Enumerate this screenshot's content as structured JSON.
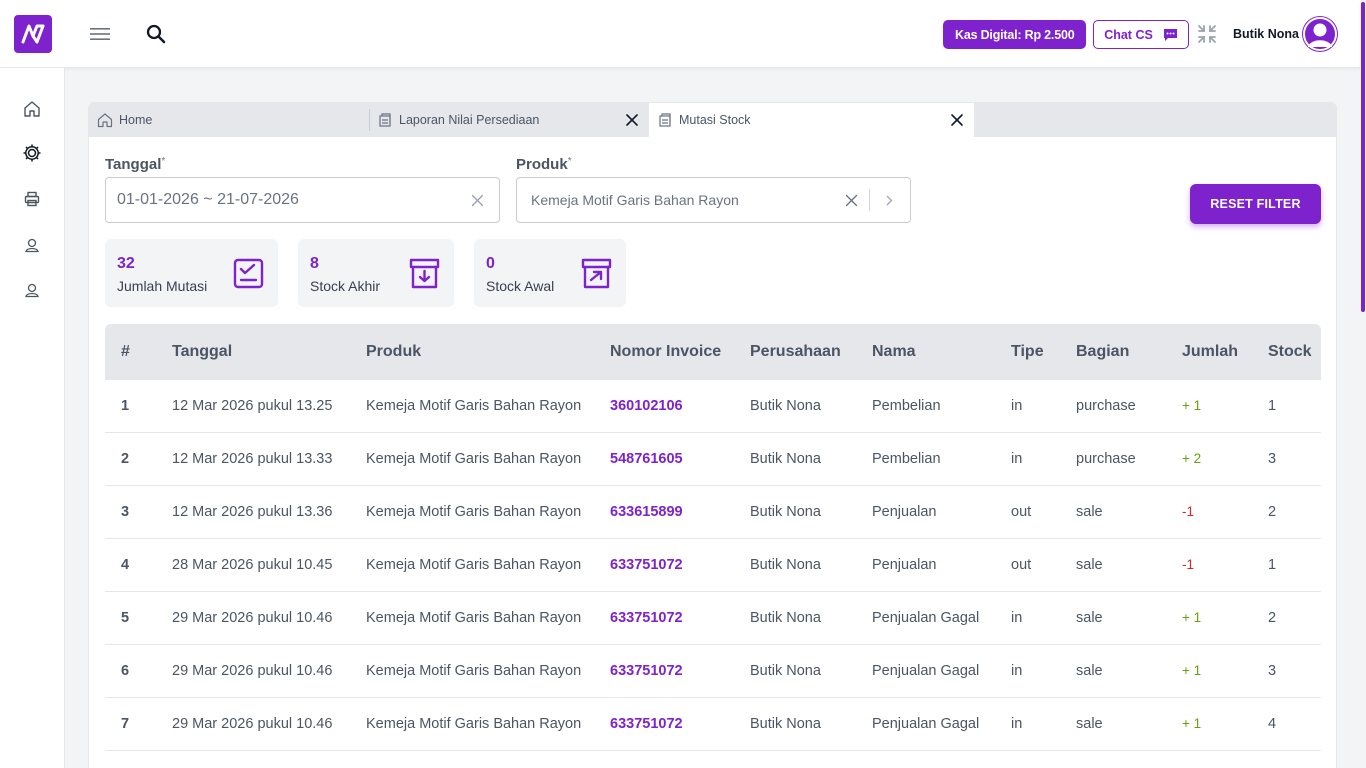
{
  "header": {
    "kas_label": "Kas Digital: Rp 2.500",
    "chat_label": "Chat CS",
    "user_name": "Butik Nona"
  },
  "tabs": [
    {
      "label": "Home",
      "closable": false
    },
    {
      "label": "Laporan Nilai Persediaan",
      "closable": true
    },
    {
      "label": "Mutasi Stock",
      "closable": true,
      "active": true
    }
  ],
  "filters": {
    "tanggal_label": "Tanggal",
    "tanggal_value": "01-01-2026 ~ 21-07-2026",
    "produk_label": "Produk",
    "produk_value": "Kemeja Motif Garis Bahan Rayon",
    "required_mark": "*",
    "reset_label": "RESET FILTER"
  },
  "stats": [
    {
      "value": "32",
      "label": "Jumlah Mutasi",
      "icon": "checklist-icon"
    },
    {
      "value": "8",
      "label": "Stock Akhir",
      "icon": "archive-in-icon"
    },
    {
      "value": "0",
      "label": "Stock Awal",
      "icon": "archive-out-icon"
    }
  ],
  "table": {
    "columns": [
      "#",
      "Tanggal",
      "Produk",
      "Nomor Invoice",
      "Perusahaan",
      "Nama",
      "Tipe",
      "Bagian",
      "Jumlah",
      "Stock"
    ],
    "rows": [
      {
        "no": "1",
        "tanggal": "12 Mar 2026 pukul 13.25",
        "produk": "Kemeja Motif Garis Bahan Rayon",
        "invoice": "360102106",
        "perusahaan": "Butik Nona",
        "nama": "Pembelian",
        "tipe": "in",
        "bagian": "purchase",
        "jumlah": "+ 1",
        "stock": "1"
      },
      {
        "no": "2",
        "tanggal": "12 Mar 2026 pukul 13.33",
        "produk": "Kemeja Motif Garis Bahan Rayon",
        "invoice": "548761605",
        "perusahaan": "Butik Nona",
        "nama": "Pembelian",
        "tipe": "in",
        "bagian": "purchase",
        "jumlah": "+ 2",
        "stock": "3"
      },
      {
        "no": "3",
        "tanggal": "12 Mar 2026 pukul 13.36",
        "produk": "Kemeja Motif Garis Bahan Rayon",
        "invoice": "633615899",
        "perusahaan": "Butik Nona",
        "nama": "Penjualan",
        "tipe": "out",
        "bagian": "sale",
        "jumlah": "-1",
        "stock": "2"
      },
      {
        "no": "4",
        "tanggal": "28 Mar 2026 pukul 10.45",
        "produk": "Kemeja Motif Garis Bahan Rayon",
        "invoice": "633751072",
        "perusahaan": "Butik Nona",
        "nama": "Penjualan",
        "tipe": "out",
        "bagian": "sale",
        "jumlah": "-1",
        "stock": "1"
      },
      {
        "no": "5",
        "tanggal": "29 Mar 2026 pukul 10.46",
        "produk": "Kemeja Motif Garis Bahan Rayon",
        "invoice": "633751072",
        "perusahaan": "Butik Nona",
        "nama": "Penjualan Gagal",
        "tipe": "in",
        "bagian": "sale",
        "jumlah": "+ 1",
        "stock": "2"
      },
      {
        "no": "6",
        "tanggal": "29 Mar 2026 pukul 10.46",
        "produk": "Kemeja Motif Garis Bahan Rayon",
        "invoice": "633751072",
        "perusahaan": "Butik Nona",
        "nama": "Penjualan Gagal",
        "tipe": "in",
        "bagian": "sale",
        "jumlah": "+ 1",
        "stock": "3"
      },
      {
        "no": "7",
        "tanggal": "29 Mar 2026 pukul 10.46",
        "produk": "Kemeja Motif Garis Bahan Rayon",
        "invoice": "633751072",
        "perusahaan": "Butik Nona",
        "nama": "Penjualan Gagal",
        "tipe": "in",
        "bagian": "sale",
        "jumlah": "+ 1",
        "stock": "4"
      }
    ]
  },
  "colors": {
    "brand": "#7e22ce",
    "positive": "#65a30d",
    "negative": "#dc2626"
  }
}
